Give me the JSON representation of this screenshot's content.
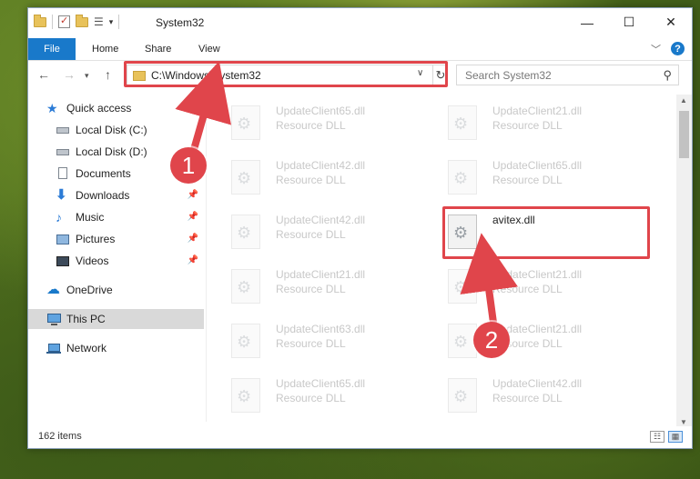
{
  "window": {
    "title": "System32",
    "controls": {
      "minimize": "—",
      "maximize": "☐",
      "close": "✕"
    }
  },
  "ribbon": {
    "tabs": [
      "File",
      "Home",
      "Share",
      "View"
    ],
    "help": "?"
  },
  "nav": {
    "address": "C:\\Windows\\System32",
    "search_placeholder": "Search System32"
  },
  "sidebar": {
    "items": [
      {
        "label": "Quick access",
        "icon": "star-icon",
        "pinned": false
      },
      {
        "label": "Local Disk (C:)",
        "icon": "drive-icon",
        "pinned": false
      },
      {
        "label": "Local Disk (D:)",
        "icon": "drive-icon",
        "pinned": false
      },
      {
        "label": "Documents",
        "icon": "document-icon",
        "pinned": false
      },
      {
        "label": "Downloads",
        "icon": "download-icon",
        "pinned": true
      },
      {
        "label": "Music",
        "icon": "music-icon",
        "pinned": true
      },
      {
        "label": "Pictures",
        "icon": "picture-icon",
        "pinned": true
      },
      {
        "label": "Videos",
        "icon": "video-icon",
        "pinned": true
      },
      {
        "label": "OneDrive",
        "icon": "cloud-icon",
        "pinned": false
      },
      {
        "label": "This PC",
        "icon": "computer-icon",
        "pinned": false,
        "selected": true
      },
      {
        "label": "Network",
        "icon": "network-icon",
        "pinned": false
      }
    ]
  },
  "files": [
    {
      "name": "UpdateClient65.dll",
      "type": "Resource DLL",
      "faded": true
    },
    {
      "name": "UpdateClient21.dll",
      "type": "Resource DLL",
      "faded": true
    },
    {
      "name": "UpdateClient42.dll",
      "type": "Resource DLL",
      "faded": true
    },
    {
      "name": "UpdateClient65.dll",
      "type": "Resource DLL",
      "faded": true
    },
    {
      "name": "UpdateClient42.dll",
      "type": "Resource DLL",
      "faded": true
    },
    {
      "name": "avitex.dll",
      "type": "",
      "faded": false
    },
    {
      "name": "UpdateClient21.dll",
      "type": "Resource DLL",
      "faded": true
    },
    {
      "name": "UpdateClient21.dll",
      "type": "Resource DLL",
      "faded": true
    },
    {
      "name": "UpdateClient63.dll",
      "type": "Resource DLL",
      "faded": true
    },
    {
      "name": "UpdateClient21.dll",
      "type": "Resource DLL",
      "faded": true
    },
    {
      "name": "UpdateClient65.dll",
      "type": "Resource DLL",
      "faded": true
    },
    {
      "name": "UpdateClient42.dll",
      "type": "Resource DLL",
      "faded": true
    }
  ],
  "status": {
    "item_count": "162 items"
  },
  "annotations": {
    "badge1": "1",
    "badge2": "2",
    "color": "#e0454b"
  }
}
